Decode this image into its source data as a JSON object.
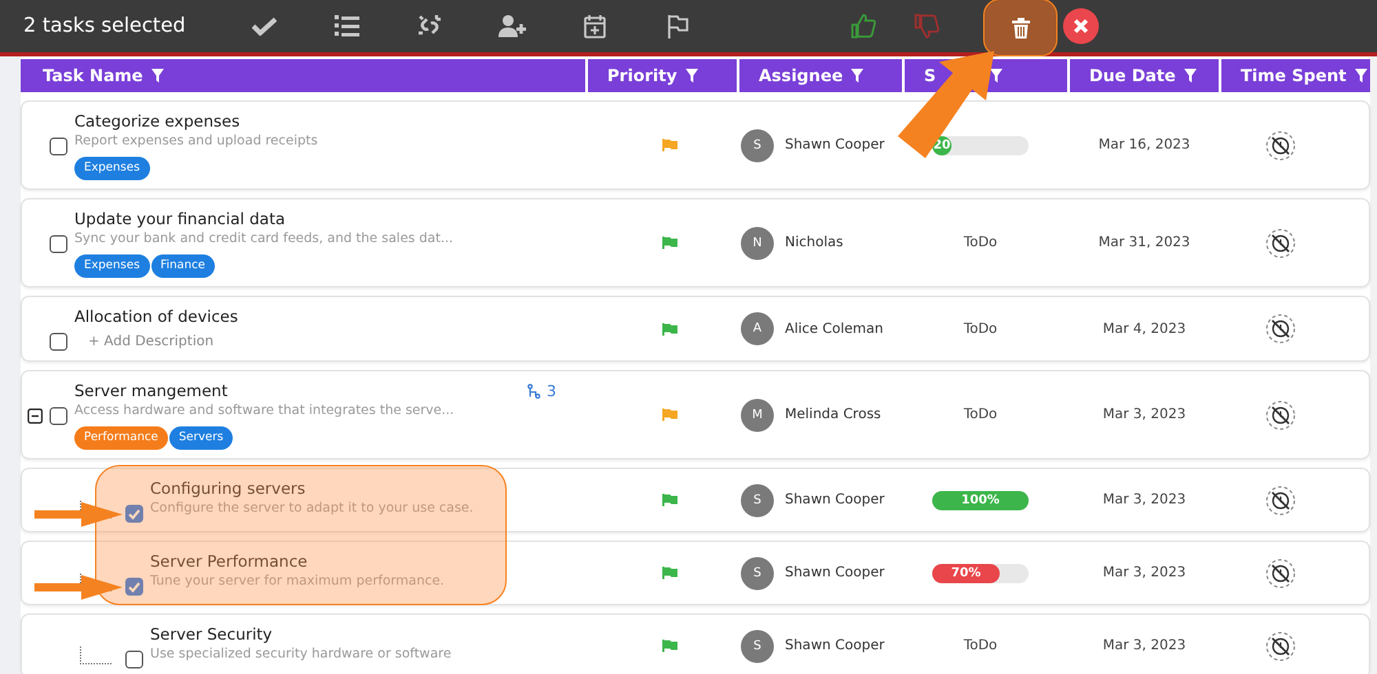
{
  "toolbar": {
    "selection_text": "2 tasks selected",
    "actions": [
      {
        "kind": "complete"
      },
      {
        "kind": "order"
      },
      {
        "kind": "unlink"
      },
      {
        "kind": "assign"
      },
      {
        "kind": "schedule"
      },
      {
        "kind": "flag"
      },
      {
        "kind": "like"
      },
      {
        "kind": "dislike"
      },
      {
        "kind": "delete",
        "highlighted": true
      },
      {
        "kind": "cancel"
      }
    ]
  },
  "table": {
    "columns": [
      {
        "label": "Task Name"
      },
      {
        "label": "Priority"
      },
      {
        "label": "Assignee"
      },
      {
        "label": "S"
      },
      {
        "label": "Due Date"
      },
      {
        "label": "Time Spent"
      }
    ],
    "rows": [
      {
        "title": "Categorize expenses",
        "description": {
          "text": "Report expenses and upload receipts",
          "kind": "text"
        },
        "tags": [
          {
            "label": "Expenses",
            "color": "#1e7fe0"
          }
        ],
        "checked": false,
        "highlighted": false,
        "priority": {
          "color": "#f5a623"
        },
        "assignee": {
          "initial": "S",
          "name": "Shawn Cooper"
        },
        "status": {
          "kind": "progress",
          "label": "20",
          "level": 0.2,
          "color": "#3cb64a"
        },
        "due": "Mar 16, 2023"
      },
      {
        "title": "Update your financial data",
        "description": {
          "text": "Sync your bank and credit card feeds, and the sales dat...",
          "kind": "text"
        },
        "tags": [
          {
            "label": "Expenses",
            "color": "#1e7fe0"
          },
          {
            "label": "Finance",
            "color": "#1e7fe0"
          }
        ],
        "checked": false,
        "highlighted": false,
        "priority": {
          "color": "#3cb64a"
        },
        "assignee": {
          "initial": "N",
          "name": "Nicholas"
        },
        "status": {
          "kind": "text",
          "label": "ToDo"
        },
        "due": "Mar 31, 2023"
      },
      {
        "title": "Allocation of devices",
        "description": {
          "text": "+ Add Description",
          "kind": "placeholder"
        },
        "checked": false,
        "highlighted": false,
        "priority": {
          "color": "#3cb64a"
        },
        "assignee": {
          "initial": "A",
          "name": "Alice Coleman"
        },
        "status": {
          "kind": "text",
          "label": "ToDo"
        },
        "due": "Mar 4, 2023"
      },
      {
        "title": "Server mangement",
        "description": {
          "text": "Access hardware and software that integrates the serve...",
          "kind": "text"
        },
        "tags": [
          {
            "label": "Performance",
            "color": "#f57c1a"
          },
          {
            "label": "Servers",
            "color": "#1e7fe0"
          }
        ],
        "checked": false,
        "highlighted": false,
        "expanded": true,
        "subtask_count": "3",
        "priority": {
          "color": "#f5a623"
        },
        "assignee": {
          "initial": "M",
          "name": "Melinda Cross"
        },
        "status": {
          "kind": "text",
          "label": "ToDo"
        },
        "due": "Mar 3, 2023",
        "children": [
          {
            "title": "Configuring servers",
            "description": {
              "text": "Configure the server to adapt it to your use case.",
              "kind": "text"
            },
            "checked": true,
            "highlighted": true,
            "priority": {
              "color": "#3cb64a"
            },
            "assignee": {
              "initial": "S",
              "name": "Shawn Cooper"
            },
            "status": {
              "kind": "progress",
              "label": "100%",
              "level": 1,
              "color": "#3cb64a"
            },
            "due": "Mar 3, 2023"
          },
          {
            "title": "Server Performance",
            "description": {
              "text": "Tune your server for maximum performance.",
              "kind": "text"
            },
            "checked": true,
            "highlighted": true,
            "priority": {
              "color": "#3cb64a"
            },
            "assignee": {
              "initial": "S",
              "name": "Shawn Cooper"
            },
            "status": {
              "kind": "progress",
              "label": "70%",
              "level": 0.7,
              "color": "#e8464a"
            },
            "due": "Mar 3, 2023"
          },
          {
            "title": "Server Security",
            "description": {
              "text": "Use specialized security hardware or software",
              "kind": "text"
            },
            "checked": false,
            "highlighted": false,
            "priority": {
              "color": "#3cb64a"
            },
            "assignee": {
              "initial": "S",
              "name": "Shawn Cooper"
            },
            "status": {
              "kind": "text",
              "label": "ToDo"
            },
            "due": "Mar 3, 2023"
          }
        ]
      }
    ]
  }
}
